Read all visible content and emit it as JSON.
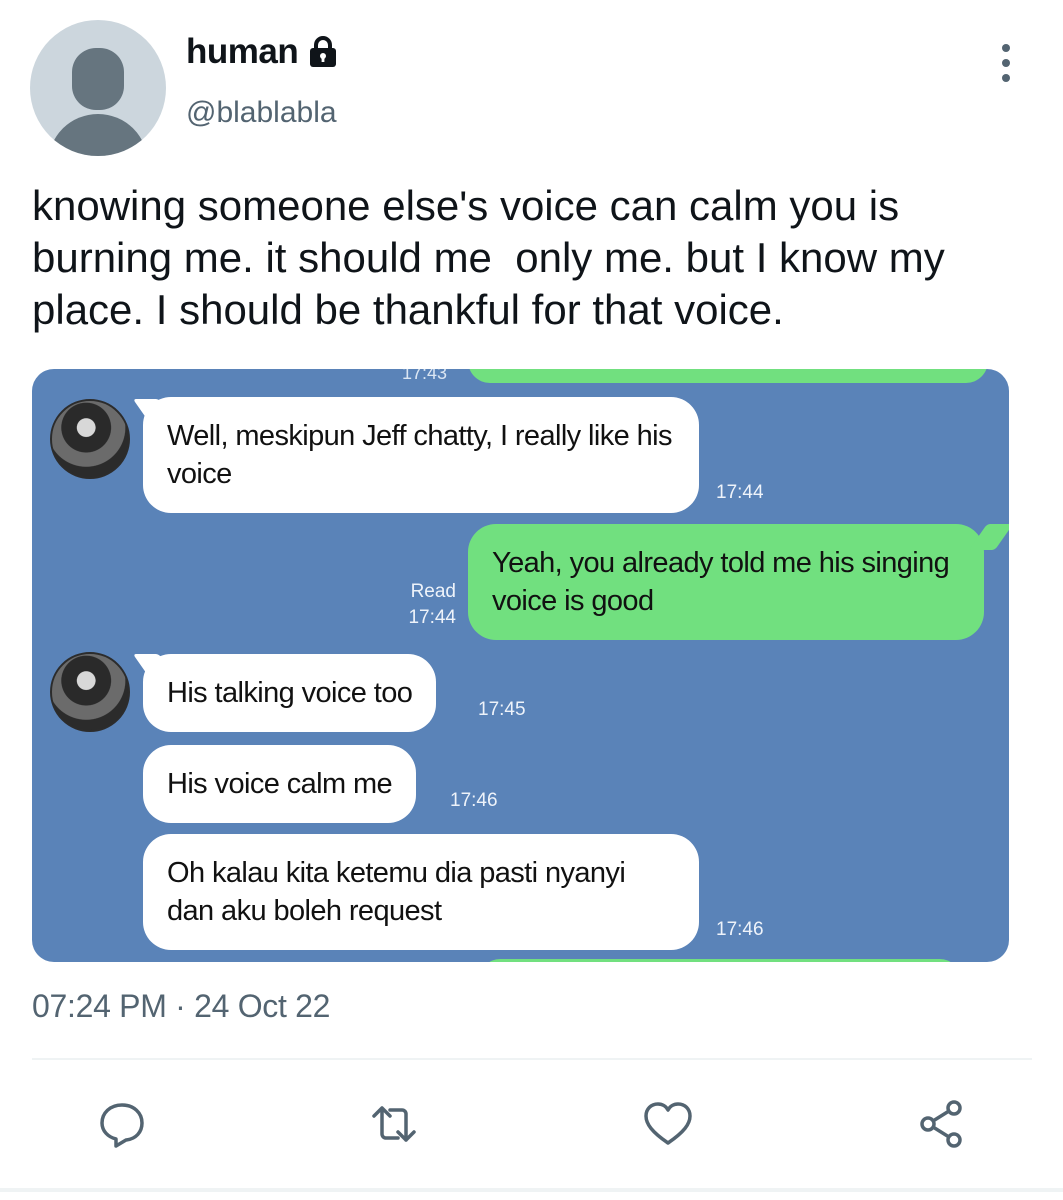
{
  "tweet": {
    "display_name": "human",
    "handle": "@blablabla",
    "text": "knowing someone else's voice can calm you is burning me. it should me  only me. but I know my place. I should be thankful for that voice.",
    "timestamp": "07:24 PM · 24 Oct 22"
  },
  "chat": {
    "top_time_partial": "17:43",
    "messages": [
      {
        "side": "in",
        "text": "Well, meskipun Jeff chatty, I really like his voice",
        "time": "17:44"
      },
      {
        "side": "out",
        "text": "Yeah, you already told me his singing voice is good",
        "read": "Read",
        "time": "17:44"
      },
      {
        "side": "in",
        "text": "His talking voice too",
        "time": "17:45"
      },
      {
        "side": "in",
        "text": "His voice calm me",
        "time": "17:46"
      },
      {
        "side": "in",
        "text": "Oh kalau kita ketemu dia pasti nyanyi dan aku boleh request",
        "time": "17:46"
      }
    ]
  },
  "actions": [
    "reply-icon",
    "retweet-icon",
    "like-icon",
    "share-icon"
  ],
  "colors": {
    "chat_background": "#5a83b8",
    "outgoing_bubble": "#71e07f",
    "icon_gray": "#536471"
  }
}
